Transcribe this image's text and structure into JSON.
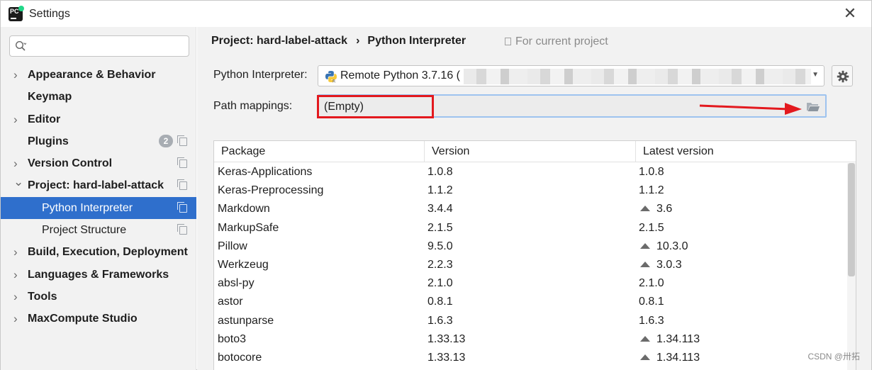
{
  "window": {
    "title": "Settings",
    "close_glyph": "✕"
  },
  "sidebar": {
    "search_placeholder": "",
    "items": [
      {
        "label": "Appearance & Behavior",
        "expandable": true
      },
      {
        "label": "Keymap",
        "expandable": false
      },
      {
        "label": "Editor",
        "expandable": true
      },
      {
        "label": "Plugins",
        "expandable": false,
        "badge": "2",
        "copy_icon": true
      },
      {
        "label": "Version Control",
        "expandable": true,
        "copy_icon": true
      },
      {
        "label": "Project: hard-label-attack",
        "expandable": true,
        "expanded": true,
        "copy_icon": true
      },
      {
        "label": "Python Interpreter",
        "child": true,
        "selected": true,
        "copy_icon": true
      },
      {
        "label": "Project Structure",
        "child": true,
        "copy_icon": true
      },
      {
        "label": "Build, Execution, Deployment",
        "expandable": true
      },
      {
        "label": "Languages & Frameworks",
        "expandable": true
      },
      {
        "label": "Tools",
        "expandable": true
      },
      {
        "label": "MaxCompute Studio",
        "expandable": true
      }
    ]
  },
  "breadcrumb": {
    "project": "Project: hard-label-attack",
    "separator": "›",
    "page": "Python Interpreter"
  },
  "scope_note": "For current project",
  "interpreter": {
    "label": "Python Interpreter:",
    "value": "Remote Python 3.7.16 ("
  },
  "path_mappings": {
    "label": "Path mappings:",
    "value": "(Empty)"
  },
  "table": {
    "columns": [
      "Package",
      "Version",
      "Latest version"
    ],
    "rows": [
      {
        "package": "Keras-Applications",
        "version": "1.0.8",
        "latest": "1.0.8",
        "upgrade": false
      },
      {
        "package": "Keras-Preprocessing",
        "version": "1.1.2",
        "latest": "1.1.2",
        "upgrade": false
      },
      {
        "package": "Markdown",
        "version": "3.4.4",
        "latest": "3.6",
        "upgrade": true
      },
      {
        "package": "MarkupSafe",
        "version": "2.1.5",
        "latest": "2.1.5",
        "upgrade": false
      },
      {
        "package": "Pillow",
        "version": "9.5.0",
        "latest": "10.3.0",
        "upgrade": true
      },
      {
        "package": "Werkzeug",
        "version": "2.2.3",
        "latest": "3.0.3",
        "upgrade": true
      },
      {
        "package": "absl-py",
        "version": "2.1.0",
        "latest": "2.1.0",
        "upgrade": false
      },
      {
        "package": "astor",
        "version": "0.8.1",
        "latest": "0.8.1",
        "upgrade": false
      },
      {
        "package": "astunparse",
        "version": "1.6.3",
        "latest": "1.6.3",
        "upgrade": false
      },
      {
        "package": "boto3",
        "version": "1.33.13",
        "latest": "1.34.113",
        "upgrade": true
      },
      {
        "package": "botocore",
        "version": "1.33.13",
        "latest": "1.34.113",
        "upgrade": true
      }
    ]
  },
  "watermark": "CSDN @卅拓",
  "colors": {
    "selection": "#2f6fcc",
    "highlight_box": "#e3191e",
    "arrow": "#e3191e"
  }
}
